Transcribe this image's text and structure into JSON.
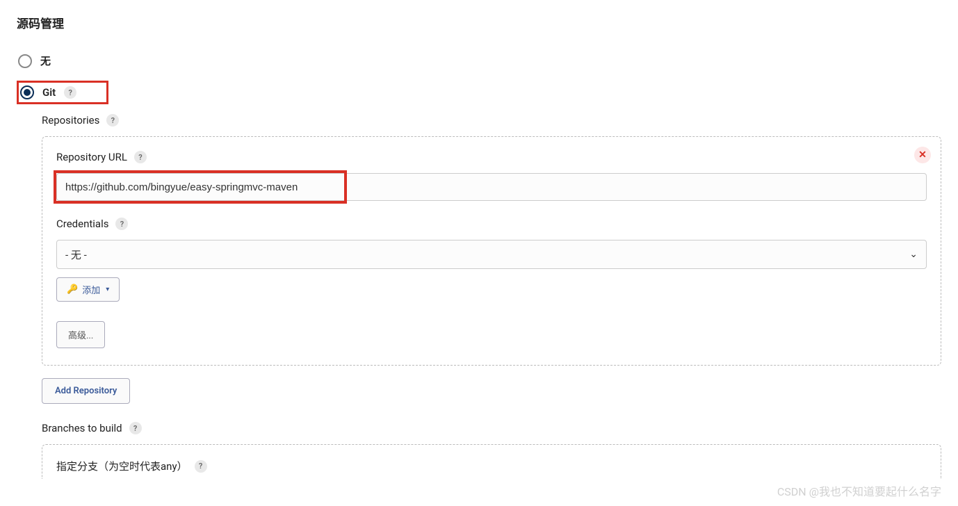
{
  "section_title": "源码管理",
  "scm_options": {
    "none_label": "无",
    "git_label": "Git"
  },
  "repositories": {
    "label": "Repositories",
    "repo_url_label": "Repository URL",
    "repo_url_value": "https://github.com/bingyue/easy-springmvc-maven",
    "credentials_label": "Credentials",
    "credentials_selected": "- 无 -",
    "add_button_label": "添加",
    "advanced_button_label": "高级...",
    "add_repository_button": "Add Repository"
  },
  "branches": {
    "label": "Branches to build",
    "branch_specifier_label": "指定分支（为空时代表any）"
  },
  "help_icon_text": "?",
  "close_icon_text": "✕",
  "watermark": "CSDN @我也不知道要起什么名字"
}
